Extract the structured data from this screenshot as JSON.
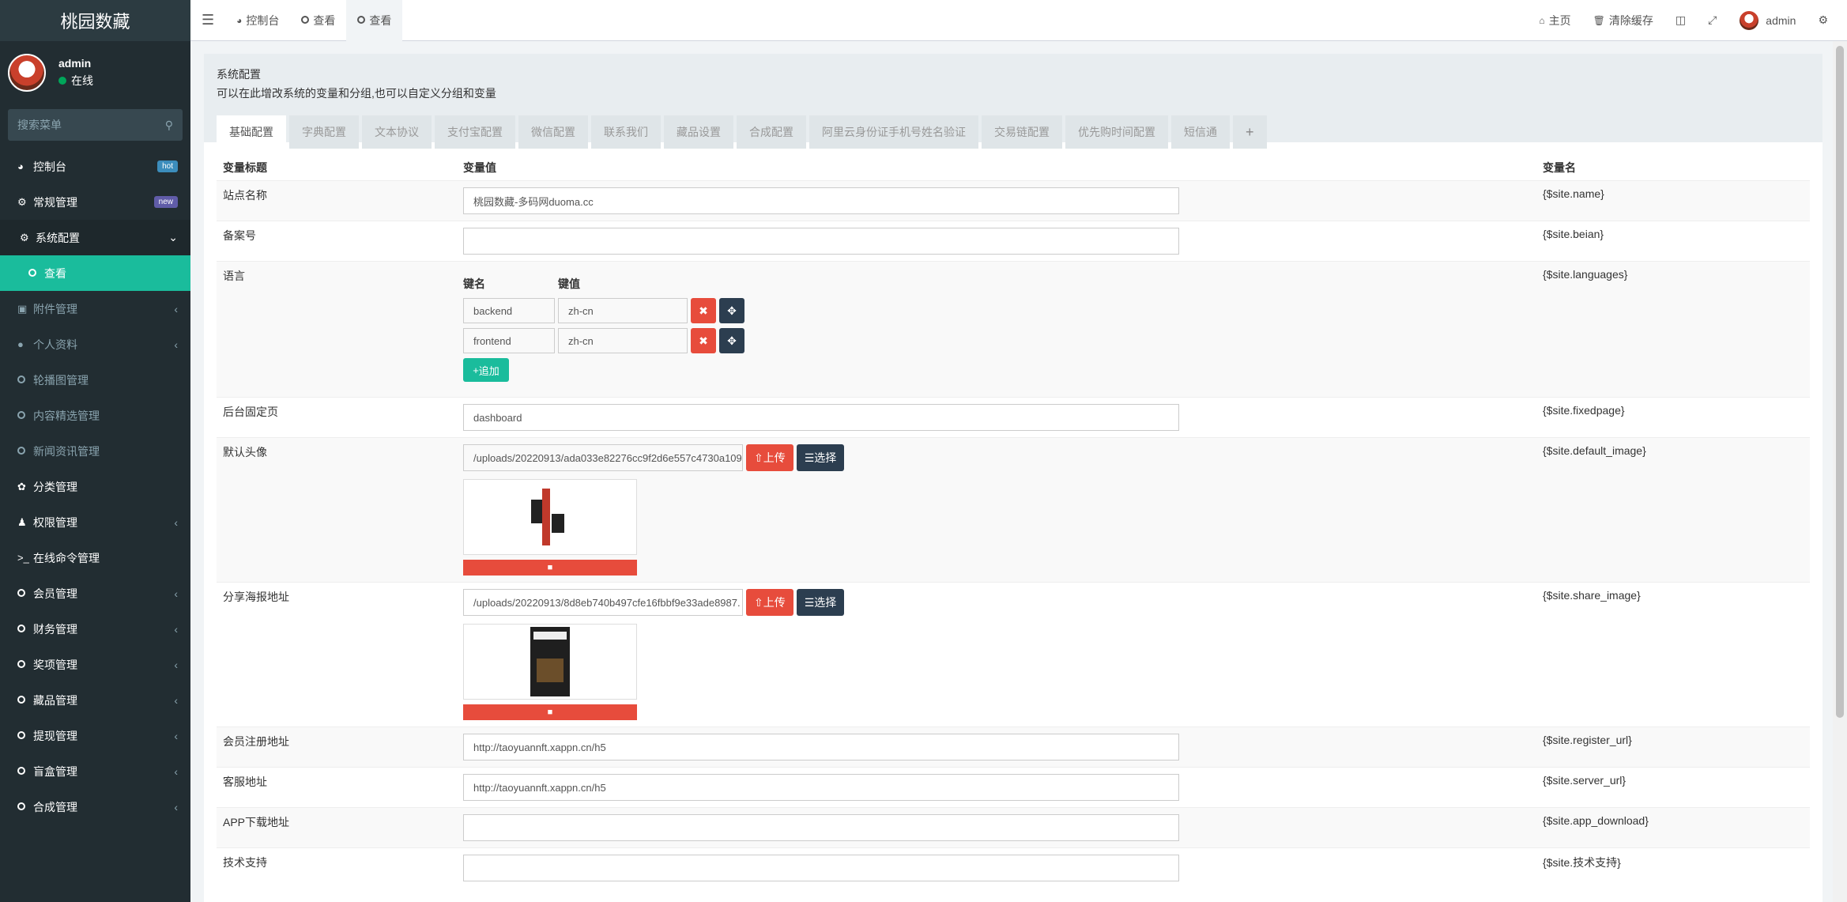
{
  "app": {
    "title": "桃园数藏"
  },
  "user": {
    "name": "admin",
    "status": "在线"
  },
  "sidebar": {
    "search_placeholder": "搜索菜单",
    "items": [
      {
        "label": "控制台",
        "icon": "dashboard-icon",
        "badge": "hot"
      },
      {
        "label": "常规管理",
        "icon": "cogs-icon",
        "badge": "new"
      },
      {
        "label": "系统配置",
        "icon": "gear-icon"
      },
      {
        "label": "查看",
        "icon": "circle-icon"
      },
      {
        "label": "附件管理",
        "icon": "file-image-icon"
      },
      {
        "label": "个人资料",
        "icon": "user-icon"
      },
      {
        "label": "轮播图管理",
        "icon": "circle-icon"
      },
      {
        "label": "内容精选管理",
        "icon": "circle-icon"
      },
      {
        "label": "新闻资讯管理",
        "icon": "circle-icon"
      },
      {
        "label": "分类管理",
        "icon": "leaf-icon"
      },
      {
        "label": "权限管理",
        "icon": "group-icon"
      },
      {
        "label": "在线命令管理",
        "icon": "terminal-icon"
      },
      {
        "label": "会员管理",
        "icon": "circle-icon"
      },
      {
        "label": "财务管理",
        "icon": "circle-icon"
      },
      {
        "label": "奖项管理",
        "icon": "circle-icon"
      },
      {
        "label": "藏品管理",
        "icon": "circle-icon"
      },
      {
        "label": "提现管理",
        "icon": "circle-icon"
      },
      {
        "label": "盲盒管理",
        "icon": "circle-icon"
      },
      {
        "label": "合成管理",
        "icon": "circle-icon"
      }
    ]
  },
  "topbar": {
    "tabs": [
      "控制台",
      "查看",
      "查看"
    ],
    "home": "主页",
    "clear_cache": "清除缓存",
    "admin": "admin"
  },
  "panel": {
    "title": "系统配置",
    "desc": "可以在此增改系统的变量和分组,也可以自定义分组和变量",
    "tabs": [
      "基础配置",
      "字典配置",
      "文本协议",
      "支付宝配置",
      "微信配置",
      "联系我们",
      "藏品设置",
      "合成配置",
      "阿里云身份证手机号姓名验证",
      "交易链配置",
      "优先购时间配置",
      "短信通",
      "+"
    ]
  },
  "table": {
    "headers": [
      "变量标题",
      "变量值",
      "变量名"
    ],
    "rows": {
      "name": {
        "title": "站点名称",
        "value": "桃园数藏-多码网duoma.cc",
        "var": "{$site.name}"
      },
      "beian": {
        "title": "备案号",
        "value": "",
        "var": "{$site.beian}"
      },
      "languages": {
        "title": "语言",
        "var": "{$site.languages}",
        "key_head": "键名",
        "val_head": "键值",
        "pairs": [
          {
            "k": "backend",
            "v": "zh-cn"
          },
          {
            "k": "frontend",
            "v": "zh-cn"
          }
        ],
        "add_label": "追加"
      },
      "fixedpage": {
        "title": "后台固定页",
        "value": "dashboard",
        "var": "{$site.fixedpage}"
      },
      "default_image": {
        "title": "默认头像",
        "value": "/uploads/20220913/ada033e82276cc9f2d6e557c4730a109",
        "var": "{$site.default_image}"
      },
      "share_image": {
        "title": "分享海报地址",
        "value": "/uploads/20220913/8d8eb740b497cfe16fbbf9e33ade8987.",
        "var": "{$site.share_image}"
      },
      "register_url": {
        "title": "会员注册地址",
        "value": "http://taoyuannft.xappn.cn/h5",
        "var": "{$site.register_url}"
      },
      "server_url": {
        "title": "客服地址",
        "value": "http://taoyuannft.xappn.cn/h5",
        "var": "{$site.server_url}"
      },
      "app_download": {
        "title": "APP下载地址",
        "value": "",
        "var": "{$site.app_download}"
      },
      "tech": {
        "title": "技术支持",
        "value": "",
        "var": "{$site.技术支持}"
      }
    },
    "upload_label": "上传",
    "choose_label": "选择"
  },
  "colors": {
    "sidebar": "#222d32",
    "accent": "#1abc9c",
    "danger": "#e74c3c",
    "dark": "#2c3e50"
  }
}
